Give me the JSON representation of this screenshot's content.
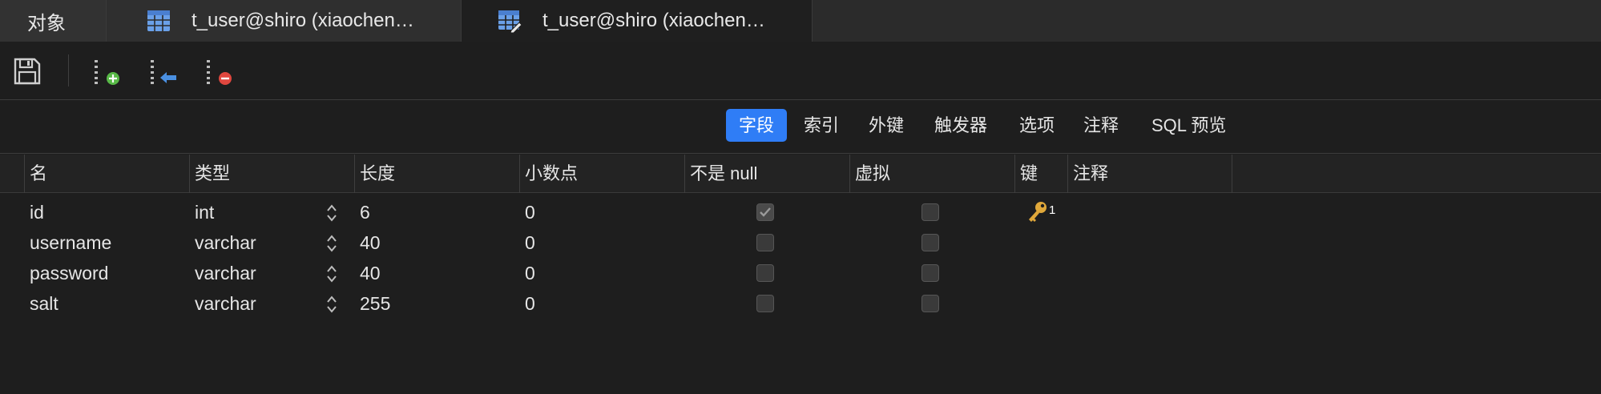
{
  "tabs": {
    "objects": "对象",
    "table_tab_1": "t_user@shiro (xiaochen…",
    "table_tab_2": "t_user@shiro (xiaochen…"
  },
  "toolbar": {
    "save_icon": "save-icon",
    "add_field_icon": "add-field-icon",
    "insert_field_icon": "insert-field-icon",
    "delete_field_icon": "delete-field-icon"
  },
  "sections": {
    "fields": "字段",
    "indexes": "索引",
    "foreign_keys": "外键",
    "triggers": "触发器",
    "options": "选项",
    "comment": "注释",
    "sql_preview": "SQL 预览"
  },
  "columns": {
    "name": "名",
    "type": "类型",
    "length": "长度",
    "decimals": "小数点",
    "not_null": "不是 null",
    "virtual": "虚拟",
    "key": "键",
    "comment": "注释"
  },
  "rows": [
    {
      "name": "id",
      "type": "int",
      "length": "6",
      "decimals": "0",
      "not_null": true,
      "virtual": false,
      "key_number": "1"
    },
    {
      "name": "username",
      "type": "varchar",
      "length": "40",
      "decimals": "0",
      "not_null": false,
      "virtual": false
    },
    {
      "name": "password",
      "type": "varchar",
      "length": "40",
      "decimals": "0",
      "not_null": false,
      "virtual": false
    },
    {
      "name": "salt",
      "type": "varchar",
      "length": "255",
      "decimals": "0",
      "not_null": false,
      "virtual": false
    }
  ],
  "colors": {
    "accent": "#2f7df6",
    "background": "#1e1e1e",
    "key": "#e0a83a"
  }
}
